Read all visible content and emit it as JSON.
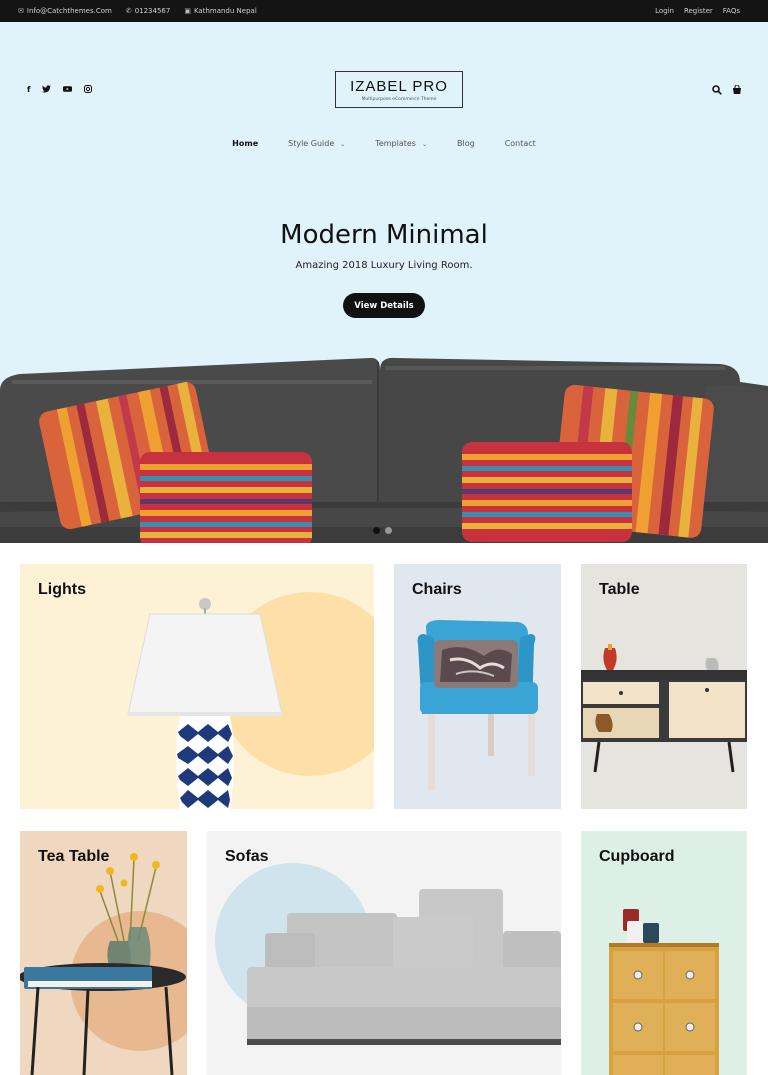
{
  "topbar": {
    "email": "Info@Catchthemes.Com",
    "phone": "01234567",
    "location": "Kathmandu Nepal",
    "links": [
      "Login",
      "Register",
      "FAQs"
    ]
  },
  "header": {
    "logo_title": "IZABEL PRO",
    "logo_tagline": "Multipurpose eCommerce Theme",
    "social_icons": [
      "facebook-icon",
      "twitter-icon",
      "youtube-icon",
      "instagram-icon"
    ]
  },
  "nav": {
    "items": [
      {
        "label": "Home",
        "active": true
      },
      {
        "label": "Style Guide",
        "dropdown": true
      },
      {
        "label": "Templates",
        "dropdown": true
      },
      {
        "label": "Blog"
      },
      {
        "label": "Contact"
      }
    ]
  },
  "hero": {
    "title": "Modern Minimal",
    "subtitle": "Amazing 2018 Luxury Living Room.",
    "button": "View Details",
    "slides": 2,
    "active_slide": 1
  },
  "categories": [
    {
      "label": "Lights"
    },
    {
      "label": "Chairs"
    },
    {
      "label": "Table"
    },
    {
      "label": "Tea Table"
    },
    {
      "label": "Sofas"
    },
    {
      "label": "Cupboard"
    }
  ],
  "colors": {
    "hero_bg": "#e0f2fa",
    "lights_bg": "#fdf1d6",
    "chairs_bg": "#e0e7ee",
    "table_bg": "#e6e4df",
    "tea_table_bg": "#f0d8c0",
    "sofas_bg": "#f3f3f3",
    "cupboard_bg": "#dcf0e8"
  }
}
